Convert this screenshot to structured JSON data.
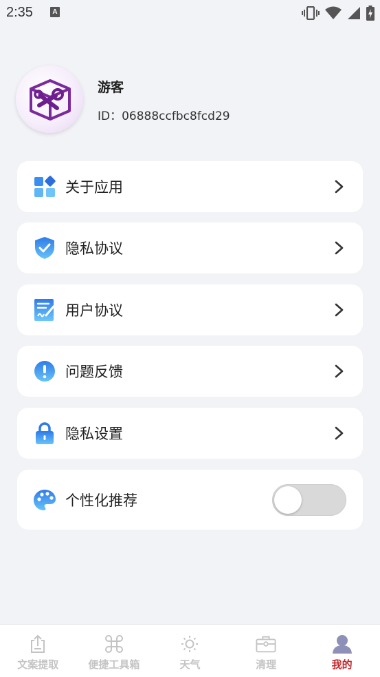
{
  "status_bar": {
    "time": "2:35",
    "notification_badge": "A"
  },
  "profile": {
    "name": "游客",
    "id_text": "ID：06888ccfbc8fcd29",
    "avatar_icon": "toolbox-wrench-icon"
  },
  "menu": [
    {
      "label": "关于应用",
      "icon": "app-grid-icon"
    },
    {
      "label": "隐私协议",
      "icon": "shield-check-icon"
    },
    {
      "label": "用户协议",
      "icon": "document-sign-icon"
    },
    {
      "label": "问题反馈",
      "icon": "exclamation-icon"
    },
    {
      "label": "隐私设置",
      "icon": "lock-icon"
    }
  ],
  "recommend": {
    "label": "个性化推荐",
    "icon": "palette-icon",
    "enabled": false
  },
  "tabs": [
    {
      "label": "文案提取",
      "icon": "share-upload-icon",
      "active": false
    },
    {
      "label": "便捷工具箱",
      "icon": "command-icon",
      "active": false
    },
    {
      "label": "天气",
      "icon": "sun-icon",
      "active": false
    },
    {
      "label": "清理",
      "icon": "briefcase-icon",
      "active": false
    },
    {
      "label": "我的",
      "icon": "person-icon",
      "active": true
    }
  ],
  "colors": {
    "accent_active": "#c0282d",
    "icon_blue": "#3a8ef0",
    "background": "#f2f3f7"
  }
}
